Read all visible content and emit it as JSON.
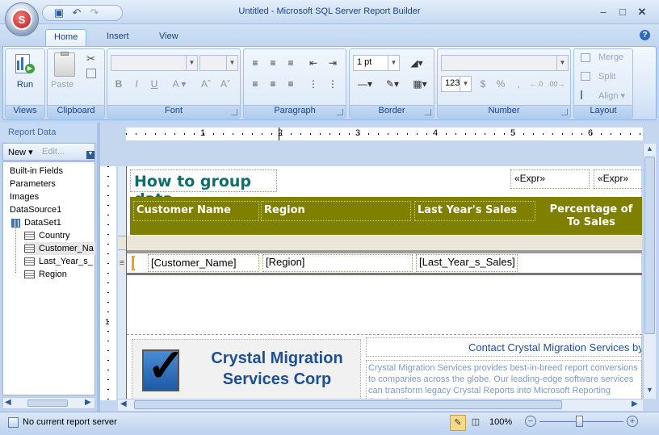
{
  "window": {
    "title": "Untitled - Microsoft SQL Server Report Builder",
    "minimize": "–",
    "maximize": "□",
    "close": "✕"
  },
  "qat": {
    "save_icon": "save-icon",
    "undo_icon": "undo-icon",
    "redo_icon": "redo-icon"
  },
  "tabs": [
    {
      "label": "Home",
      "active": true
    },
    {
      "label": "Insert",
      "active": false
    },
    {
      "label": "View",
      "active": false
    }
  ],
  "ribbon": {
    "groups": {
      "views": "Views",
      "clipboard": "Clipboard",
      "font": "Font",
      "paragraph": "Paragraph",
      "border": "Border",
      "number": "Number",
      "layout": "Layout"
    },
    "run_label": "Run",
    "paste_label": "Paste",
    "border_width": "1 pt",
    "number_format": "123",
    "currency": "$",
    "percent": "%",
    "comma": ",",
    "merge_label": "Merge",
    "split_label": "Split",
    "align_label": "Align"
  },
  "report_data": {
    "title": "Report Data",
    "new_label": "New",
    "edit_label": "Edit...",
    "items": [
      {
        "label": "Built-in Fields",
        "indent": 0
      },
      {
        "label": "Parameters",
        "indent": 0
      },
      {
        "label": "Images",
        "indent": 0
      },
      {
        "label": "DataSource1",
        "indent": 0
      },
      {
        "label": "DataSet1",
        "indent": 0
      },
      {
        "label": "Country",
        "indent": 1
      },
      {
        "label": "Customer_Na",
        "indent": 1
      },
      {
        "label": "Last_Year_s_",
        "indent": 1
      },
      {
        "label": "Region",
        "indent": 1
      }
    ]
  },
  "ruler": {
    "marks": [
      "1",
      "2",
      "3",
      "4",
      "5",
      "6"
    ]
  },
  "report": {
    "title": "How to group data",
    "expr1": "«Expr»",
    "expr2": "«Expr»",
    "headers": [
      "Customer Name",
      "Region",
      "Last Year's Sales",
      "Percentage of To Sales"
    ],
    "detail": [
      "[Customer_Name]",
      "[Region]",
      "[Last_Year_s_Sales]"
    ],
    "header_color": "#7f7f00",
    "title_color": "#0e6e6e",
    "logo_text_line1": "Crystal Migration",
    "logo_text_line2": "Services Corp",
    "contact": "Contact Crystal Migration Services by",
    "blurb": "Crystal Migration Services provides best-in-breed report conversions to companies across the globe. Our leading-edge software services can transform legacy Crystal Reports into Microsoft Reporting Services fas"
  },
  "status": {
    "server": "No current report server",
    "zoom": "100%"
  }
}
